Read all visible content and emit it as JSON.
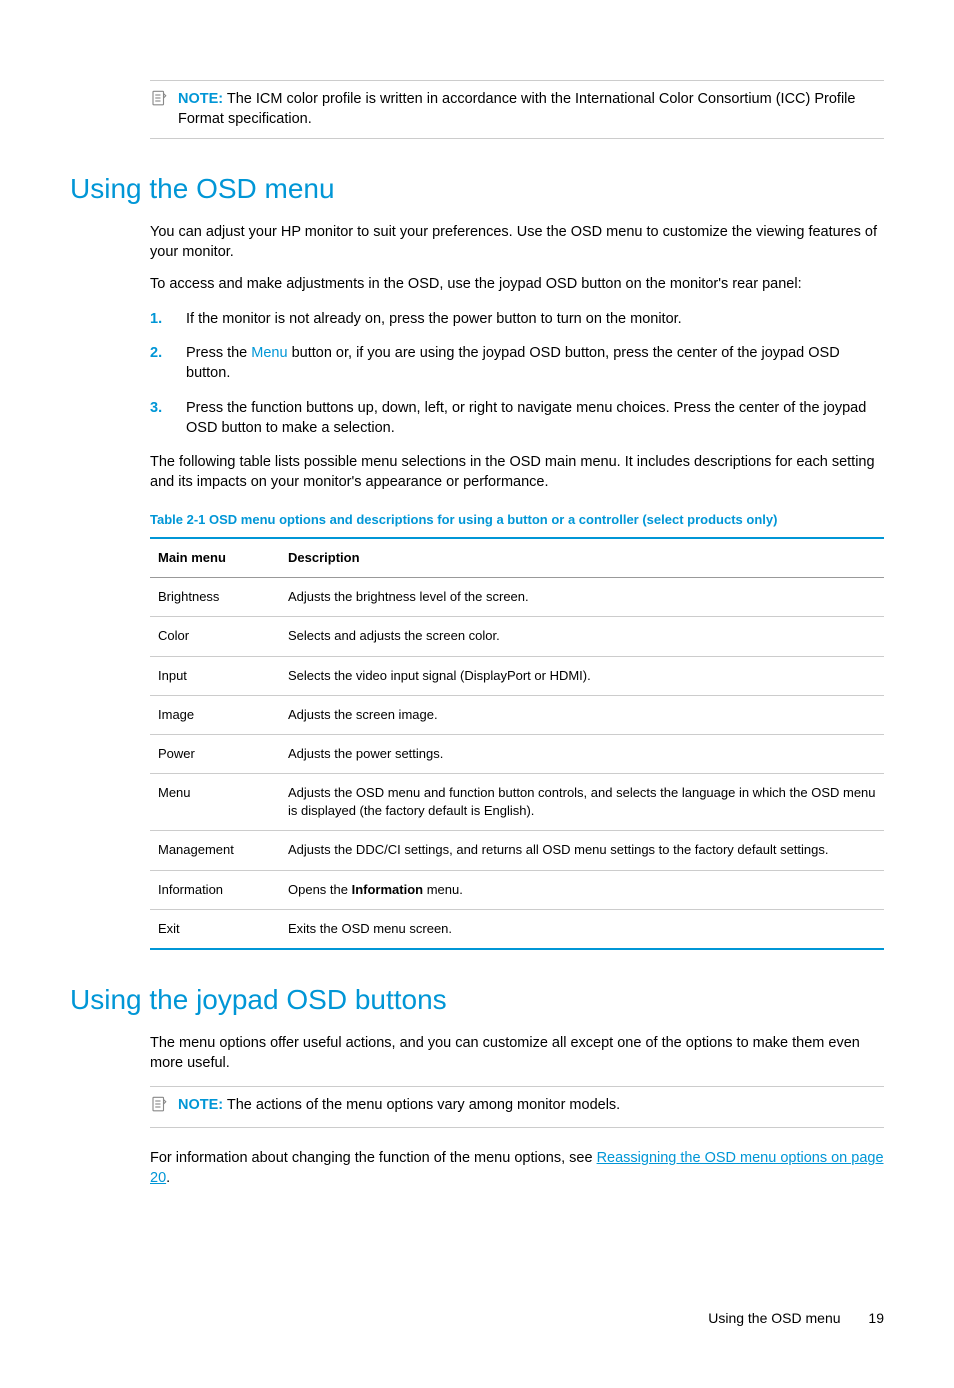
{
  "note1": {
    "label": "NOTE:",
    "text": "The ICM color profile is written in accordance with the International Color Consortium (ICC) Profile Format specification."
  },
  "section1": {
    "heading": "Using the OSD menu",
    "p1": "You can adjust your HP monitor to suit your preferences. Use the OSD menu to customize the viewing features of your monitor.",
    "p2": "To access and make adjustments in the OSD, use the joypad OSD button on the monitor's rear panel:",
    "steps": {
      "n1": "1.",
      "s1": "If the monitor is not already on, press the power button to turn on the monitor.",
      "n2": "2.",
      "s2a": "Press the ",
      "s2menu": "Menu",
      "s2b": " button or, if you are using the joypad OSD button, press the center of the joypad OSD button.",
      "n3": "3.",
      "s3": "Press the function buttons up, down, left, or right to navigate menu choices. Press the center of the joypad OSD button to make a selection."
    },
    "p3": "The following table lists possible menu selections in the OSD main menu. It includes descriptions for each setting and its impacts on your monitor's appearance or performance.",
    "tableCaptionLabel": "Table 2-1",
    "tableCaptionText": "  OSD menu options and descriptions for using a button or a controller (select products only)",
    "th1": "Main menu",
    "th2": "Description",
    "rows": {
      "r1c1": "Brightness",
      "r1c2": "Adjusts the brightness level of the screen.",
      "r2c1": "Color",
      "r2c2": "Selects and adjusts the screen color.",
      "r3c1": "Input",
      "r3c2": "Selects the video input signal (DisplayPort or HDMI).",
      "r4c1": "Image",
      "r4c2": "Adjusts the screen image.",
      "r5c1": "Power",
      "r5c2": "Adjusts the power settings.",
      "r6c1": "Menu",
      "r6c2": "Adjusts the OSD menu and function button controls, and selects the language in which the OSD menu is displayed (the factory default is English).",
      "r7c1": "Management",
      "r7c2": "Adjusts the DDC/CI settings, and returns all OSD menu settings to the factory default settings.",
      "r8c1": "Information",
      "r8c2a": "Opens the ",
      "r8c2b": "Information",
      "r8c2c": " menu.",
      "r9c1": "Exit",
      "r9c2": "Exits the OSD menu screen."
    }
  },
  "section2": {
    "heading": "Using the joypad OSD buttons",
    "p1": "The menu options offer useful actions, and you can customize all except one of the options to make them even more useful."
  },
  "note2": {
    "label": "NOTE:",
    "text": "The actions of the menu options vary among monitor models."
  },
  "p_after_note2_a": "For information about changing the function of the menu options, see ",
  "p_after_note2_link": "Reassigning the OSD menu options on page 20",
  "p_after_note2_b": ".",
  "footer": {
    "text": "Using the OSD menu",
    "page": "19"
  }
}
